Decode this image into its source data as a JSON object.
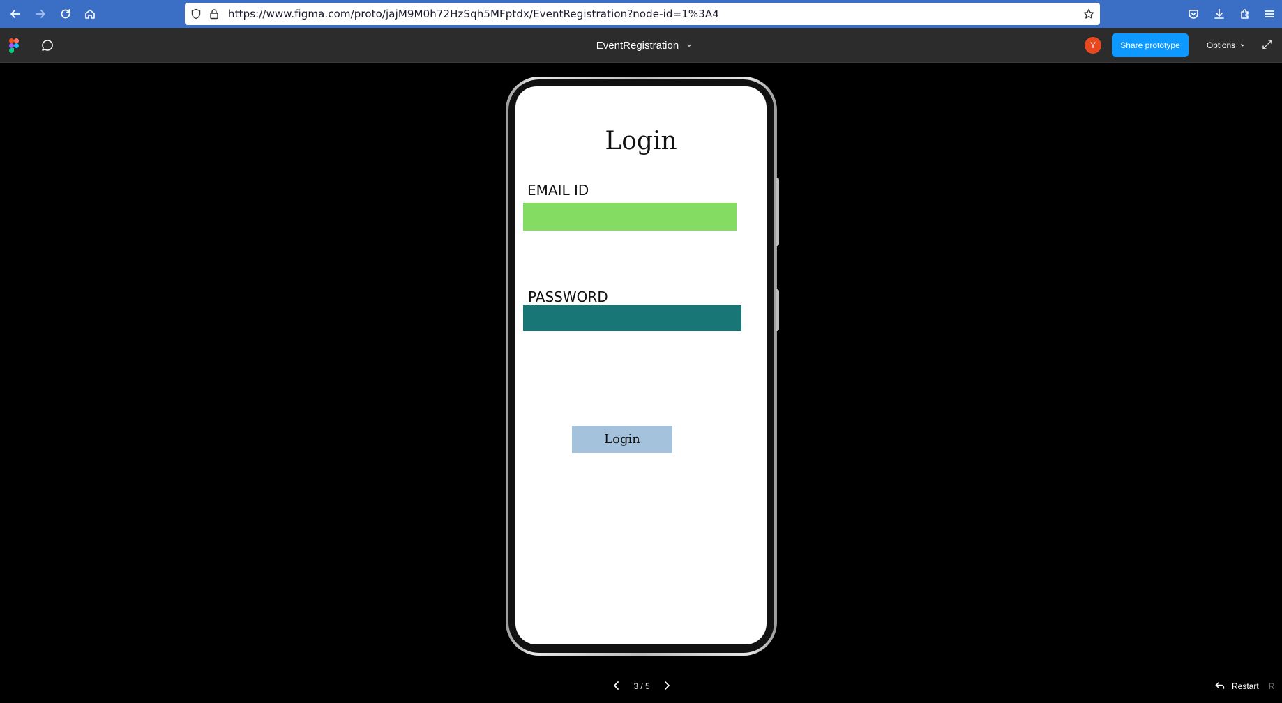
{
  "browser": {
    "url": "https://www.figma.com/proto/jajM9M0h72HzSqh5MFptdx/EventRegistration?node-id=1%3A4",
    "icons": [
      "back-arrow-icon",
      "forward-arrow-icon",
      "reload-icon",
      "home-icon",
      "shield-icon",
      "lock-icon",
      "star-icon",
      "pocket-icon",
      "download-icon",
      "extensions-icon",
      "menu-icon"
    ]
  },
  "figma_toolbar": {
    "file_name": "EventRegistration",
    "avatar_initial": "Y",
    "share_label": "Share prototype",
    "options_label": "Options"
  },
  "screen": {
    "title": "Login",
    "email_label": "EMAIL ID",
    "email_value": "",
    "password_label": "PASSWORD",
    "password_value": "",
    "login_button": "Login"
  },
  "footer": {
    "page_indicator": "3 / 5",
    "restart_label": "Restart",
    "restart_shortcut": "R"
  },
  "colors": {
    "browser_bar": "#3b6ec5",
    "figma_bar": "#2c2c2c",
    "share_button": "#0d99ff",
    "avatar": "#e8481f",
    "email_field": "#84dc63",
    "password_field": "#187677",
    "login_button": "#a4c2dc"
  }
}
